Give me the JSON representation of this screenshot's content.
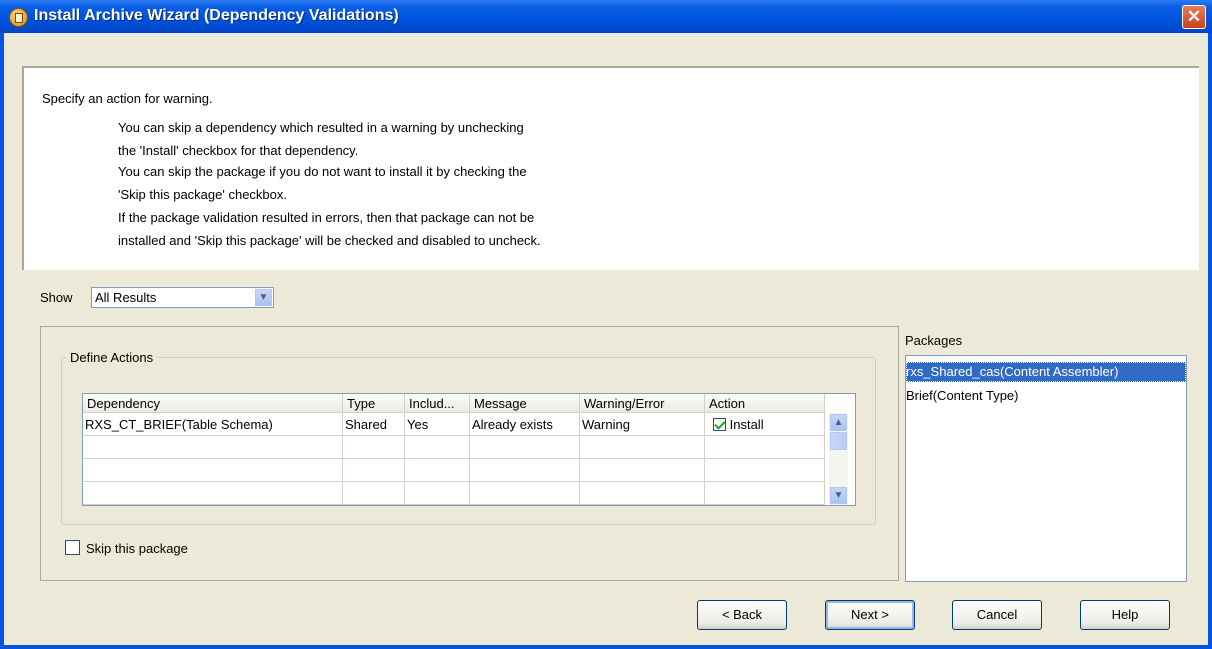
{
  "window": {
    "title": "Install Archive Wizard (Dependency Validations)",
    "close_glyph": "✕"
  },
  "description": {
    "heading": "Specify an action for warning.",
    "lines": [
      "You can skip a dependency which resulted in a warning by unchecking",
      "the 'Install' checkbox for that dependency.",
      "You can skip the package if you do not want to install it by checking the",
      "'Skip this package' checkbox.",
      "If the package validation resulted in errors, then that package can not be",
      "installed and 'Skip this package' will be checked and disabled to uncheck."
    ]
  },
  "filter": {
    "label": "Show",
    "selected": "All Results",
    "dropdown_icon": "chevron-down-icon"
  },
  "define_actions": {
    "legend": "Define Actions",
    "columns": [
      "Dependency",
      "Type",
      "Includ...",
      "Message",
      "Warning/Error",
      "Action"
    ],
    "rows": [
      {
        "dependency": "RXS_CT_BRIEF(Table Schema)",
        "type": "Shared",
        "included": "Yes",
        "message": "Already exists",
        "warning_error": "Warning",
        "action_label": "Install",
        "action_checked": true
      }
    ],
    "empty_rows": 3
  },
  "skip_package": {
    "label": "Skip this package",
    "checked": false
  },
  "packages": {
    "label": "Packages",
    "items": [
      {
        "label": "rxs_Shared_cas(Content Assembler)",
        "selected": true
      },
      {
        "label": "Brief(Content Type)",
        "selected": false
      }
    ]
  },
  "buttons": {
    "back": "< Back",
    "next": "Next >",
    "cancel": "Cancel",
    "help": "Help"
  },
  "colors": {
    "title_bar": "#0054e3",
    "selection": "#316ac5",
    "dialog_bg": "#ece9d8"
  }
}
